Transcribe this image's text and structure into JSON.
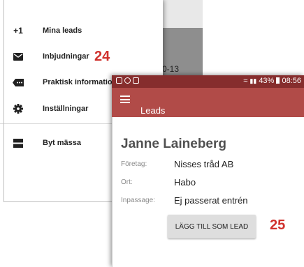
{
  "drawer": {
    "background_text": "0-13",
    "items": [
      {
        "label": "Mina leads",
        "icon": "plus-one-icon"
      },
      {
        "label": "Inbjudningar",
        "icon": "envelope-icon"
      },
      {
        "label": "Praktisk information",
        "icon": "label-dots-icon"
      },
      {
        "label": "Inställningar",
        "icon": "gear-icon"
      },
      {
        "label": "Byt mässa",
        "icon": "split-square-icon"
      }
    ],
    "plus_one_glyph": "+1"
  },
  "callouts": {
    "first": "24",
    "second": "25"
  },
  "status_bar": {
    "battery_percent": "43%",
    "time": "08:56"
  },
  "app_bar": {
    "title": "Leads"
  },
  "lead": {
    "name": "Janne Laineberg",
    "fields": [
      {
        "label": "Företag:",
        "value": "Nisses tråd AB"
      },
      {
        "label": "Ort:",
        "value": "Habo"
      },
      {
        "label": "Inpassage:",
        "value": "Ej passerat entrén"
      }
    ],
    "add_button_label": "LÄGG TILL SOM LEAD"
  },
  "colors": {
    "status_bar": "#862d2d",
    "app_bar": "#b14b48",
    "callout": "#d0312d"
  }
}
